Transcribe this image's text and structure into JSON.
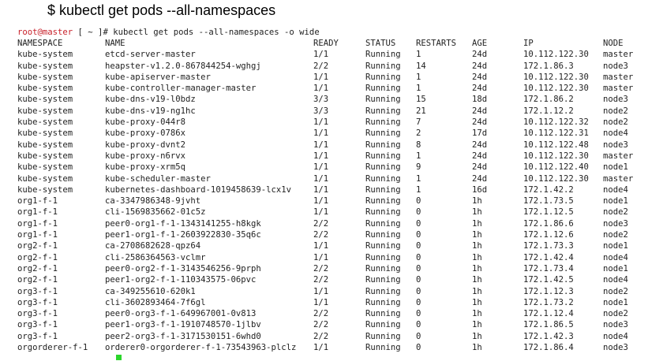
{
  "caption": "$ kubectl get pods --all-namespaces",
  "terminal": {
    "prompt_user": "root@master",
    "prompt_rest": " [ ~ ]# kubectl get pods --all-namespaces -o wide",
    "headers": [
      "NAMESPACE",
      "NAME",
      "READY",
      "STATUS",
      "RESTARTS",
      "AGE",
      "IP",
      "NODE"
    ],
    "rows": [
      [
        "kube-system",
        "etcd-server-master",
        "1/1",
        "Running",
        "1",
        "24d",
        "10.112.122.30",
        "master"
      ],
      [
        "kube-system",
        "heapster-v1.2.0-867844254-wghgj",
        "2/2",
        "Running",
        "14",
        "24d",
        "172.1.86.3",
        "node3"
      ],
      [
        "kube-system",
        "kube-apiserver-master",
        "1/1",
        "Running",
        "1",
        "24d",
        "10.112.122.30",
        "master"
      ],
      [
        "kube-system",
        "kube-controller-manager-master",
        "1/1",
        "Running",
        "1",
        "24d",
        "10.112.122.30",
        "master"
      ],
      [
        "kube-system",
        "kube-dns-v19-l0bdz",
        "3/3",
        "Running",
        "15",
        "18d",
        "172.1.86.2",
        "node3"
      ],
      [
        "kube-system",
        "kube-dns-v19-ng1hc",
        "3/3",
        "Running",
        "21",
        "24d",
        "172.1.12.2",
        "node2"
      ],
      [
        "kube-system",
        "kube-proxy-044r8",
        "1/1",
        "Running",
        "7",
        "24d",
        "10.112.122.32",
        "node2"
      ],
      [
        "kube-system",
        "kube-proxy-0786x",
        "1/1",
        "Running",
        "2",
        "17d",
        "10.112.122.31",
        "node4"
      ],
      [
        "kube-system",
        "kube-proxy-dvnt2",
        "1/1",
        "Running",
        "8",
        "24d",
        "10.112.122.48",
        "node3"
      ],
      [
        "kube-system",
        "kube-proxy-n6rvx",
        "1/1",
        "Running",
        "1",
        "24d",
        "10.112.122.30",
        "master"
      ],
      [
        "kube-system",
        "kube-proxy-xrm5q",
        "1/1",
        "Running",
        "9",
        "24d",
        "10.112.122.40",
        "node1"
      ],
      [
        "kube-system",
        "kube-scheduler-master",
        "1/1",
        "Running",
        "1",
        "24d",
        "10.112.122.30",
        "master"
      ],
      [
        "kube-system",
        "kubernetes-dashboard-1019458639-lcx1v",
        "1/1",
        "Running",
        "1",
        "16d",
        "172.1.42.2",
        "node4"
      ],
      [
        "org1-f-1",
        "ca-3347986348-9jvht",
        "1/1",
        "Running",
        "0",
        "1h",
        "172.1.73.5",
        "node1"
      ],
      [
        "org1-f-1",
        "cli-1569835662-01c5z",
        "1/1",
        "Running",
        "0",
        "1h",
        "172.1.12.5",
        "node2"
      ],
      [
        "org1-f-1",
        "peer0-org1-f-1-1343141255-h8kgk",
        "2/2",
        "Running",
        "0",
        "1h",
        "172.1.86.6",
        "node3"
      ],
      [
        "org1-f-1",
        "peer1-org1-f-1-2603922830-35q6c",
        "2/2",
        "Running",
        "0",
        "1h",
        "172.1.12.6",
        "node2"
      ],
      [
        "org2-f-1",
        "ca-2708682628-qpz64",
        "1/1",
        "Running",
        "0",
        "1h",
        "172.1.73.3",
        "node1"
      ],
      [
        "org2-f-1",
        "cli-2586364563-vclmr",
        "1/1",
        "Running",
        "0",
        "1h",
        "172.1.42.4",
        "node4"
      ],
      [
        "org2-f-1",
        "peer0-org2-f-1-3143546256-9prph",
        "2/2",
        "Running",
        "0",
        "1h",
        "172.1.73.4",
        "node1"
      ],
      [
        "org2-f-1",
        "peer1-org2-f-1-110343575-06pvc",
        "2/2",
        "Running",
        "0",
        "1h",
        "172.1.42.5",
        "node4"
      ],
      [
        "org3-f-1",
        "ca-349255610-620k1",
        "1/1",
        "Running",
        "0",
        "1h",
        "172.1.12.3",
        "node2"
      ],
      [
        "org3-f-1",
        "cli-3602893464-7f6gl",
        "1/1",
        "Running",
        "0",
        "1h",
        "172.1.73.2",
        "node1"
      ],
      [
        "org3-f-1",
        "peer0-org3-f-1-649967001-0v813",
        "2/2",
        "Running",
        "0",
        "1h",
        "172.1.12.4",
        "node2"
      ],
      [
        "org3-f-1",
        "peer1-org3-f-1-1910748570-1jlbv",
        "2/2",
        "Running",
        "0",
        "1h",
        "172.1.86.5",
        "node3"
      ],
      [
        "org3-f-1",
        "peer2-org3-f-1-3171530151-6whd0",
        "2/2",
        "Running",
        "0",
        "1h",
        "172.1.42.3",
        "node4"
      ],
      [
        "orgorderer-f-1",
        "orderer0-orgorderer-f-1-73543963-plclz",
        "1/1",
        "Running",
        "0",
        "1h",
        "172.1.86.4",
        "node3"
      ]
    ]
  },
  "colors": {
    "prompt_user": "#c8202a",
    "text": "#222222",
    "cursor": "#2bd62b"
  }
}
